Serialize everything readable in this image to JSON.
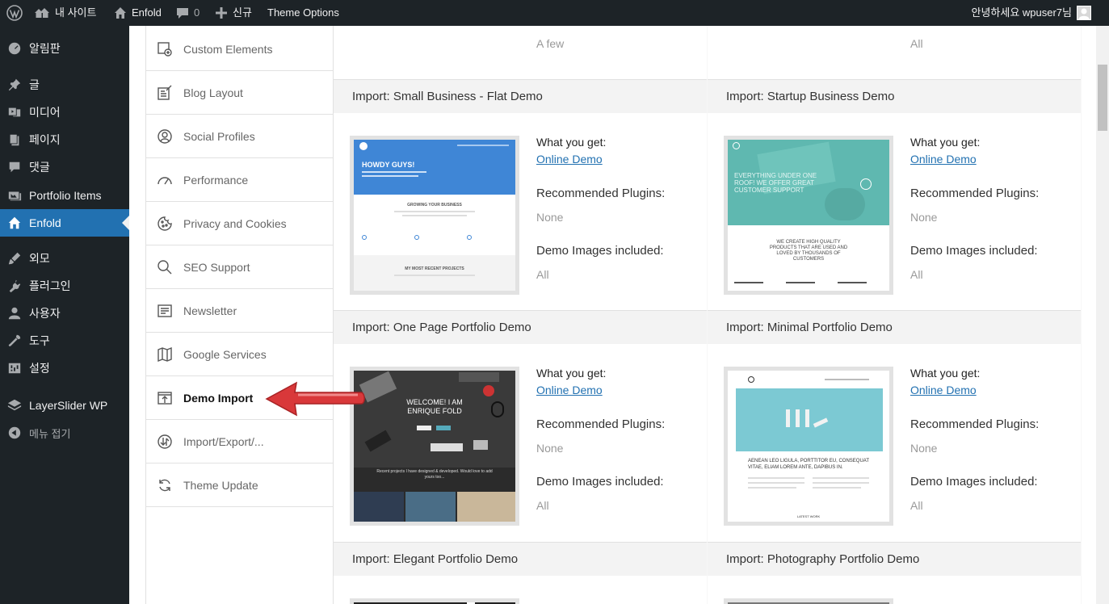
{
  "adminbar": {
    "site_name": "내 사이트",
    "theme_name": "Enfold",
    "comments_count": "0",
    "new_label": "신규",
    "theme_options": "Theme Options",
    "greeting": "안녕하세요 wpuser7님"
  },
  "sidebar": {
    "items": [
      {
        "label": "알림판",
        "icon": "dashboard-icon"
      },
      {
        "label": "글",
        "icon": "pin-icon"
      },
      {
        "label": "미디어",
        "icon": "media-icon"
      },
      {
        "label": "페이지",
        "icon": "page-icon"
      },
      {
        "label": "댓글",
        "icon": "comment-icon"
      },
      {
        "label": "Portfolio Items",
        "icon": "portfolio-icon"
      },
      {
        "label": "Enfold",
        "icon": "home-icon"
      },
      {
        "label": "외모",
        "icon": "brush-icon"
      },
      {
        "label": "플러그인",
        "icon": "plugin-icon"
      },
      {
        "label": "사용자",
        "icon": "user-icon"
      },
      {
        "label": "도구",
        "icon": "wrench-icon"
      },
      {
        "label": "설정",
        "icon": "settings-icon"
      },
      {
        "label": "LayerSlider WP",
        "icon": "layers-icon"
      },
      {
        "label": "메뉴 접기",
        "icon": "collapse-icon"
      }
    ]
  },
  "options_nav": {
    "items": [
      {
        "label": "Custom Elements"
      },
      {
        "label": "Blog Layout"
      },
      {
        "label": "Social Profiles"
      },
      {
        "label": "Performance"
      },
      {
        "label": "Privacy and Cookies"
      },
      {
        "label": "SEO Support"
      },
      {
        "label": "Newsletter"
      },
      {
        "label": "Google Services"
      },
      {
        "label": "Demo Import"
      },
      {
        "label": "Import/Export/..."
      },
      {
        "label": "Theme Update"
      }
    ]
  },
  "top_values": {
    "left": "A few",
    "right": "All"
  },
  "info_labels": {
    "what_you_get": "What you get:",
    "online_demo": "Online Demo",
    "plugins": "Recommended Plugins:",
    "images": "Demo Images included:"
  },
  "demos": [
    {
      "title": "Import: Small Business - Flat Demo",
      "plugins": "None",
      "images": "All",
      "thumb_text": {
        "hero": "HOWDY GUYS!",
        "sub": "GROWING YOUR BUSINESS",
        "footer": "MY MOST RECENT PROJECTS"
      }
    },
    {
      "title": "Import: Startup Business Demo",
      "plugins": "None",
      "images": "All",
      "thumb_text": {
        "hero": "EVERYTHING UNDER ONE ROOF! WE OFFER GREAT CUSTOMER SUPPORT",
        "sub": "WE CREATE HIGH QUALITY PRODUCTS THAT ARE USED AND LOVED BY THOUSANDS OF CUSTOMERS"
      }
    },
    {
      "title": "Import: One Page Portfolio Demo",
      "plugins": "None",
      "images": "All",
      "thumb_text": {
        "hero": "WELCOME! I AM ENRIQUE FOLD",
        "sub": "Recent projects I have designed & developed. Would love to add yours too..."
      }
    },
    {
      "title": "Import: Minimal Portfolio Demo",
      "plugins": "None",
      "images": "All",
      "thumb_text": {
        "hero": "AENEAN LEO LIGULA, PORTTITOR EU, CONSEQUAT VITAE, ELIAM LOREM ANTE, DAPIBUS IN.",
        "sub": "LATEST WORK"
      }
    },
    {
      "title": "Import: Elegant Portfolio Demo"
    },
    {
      "title": "Import: Photography Portfolio Demo"
    }
  ],
  "colors": {
    "admin_bg": "#1d2327",
    "active_blue": "#2271b1",
    "link": "#2271b1",
    "arrow_red": "#d9383a"
  }
}
